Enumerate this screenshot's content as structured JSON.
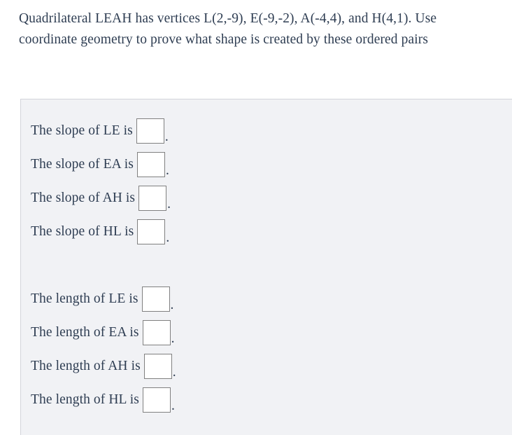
{
  "question": {
    "text": "Quadrilateral LEAH has vertices L(2,-9), E(-9,-2), A(-4,4), and H(4,1). Use coordinate geometry to prove what shape is created by these ordered pairs"
  },
  "answer_panel": {
    "background_color": "#f1f2f5",
    "border_color": "#d3d4db",
    "groups": [
      {
        "name": "slopes",
        "rows": [
          {
            "label": "The slope of LE is",
            "value": "",
            "suffix": "."
          },
          {
            "label": "The slope of EA is",
            "value": "",
            "suffix": "."
          },
          {
            "label": "The slope of AH is",
            "value": "",
            "suffix": "."
          },
          {
            "label": "The slope of HL is",
            "value": "",
            "suffix": "."
          }
        ]
      },
      {
        "name": "lengths",
        "rows": [
          {
            "label": "The length of LE is",
            "value": "",
            "suffix": "."
          },
          {
            "label": "The length of EA is",
            "value": "",
            "suffix": "."
          },
          {
            "label": "The length of AH is",
            "value": "",
            "suffix": "."
          },
          {
            "label": "The length of HL is",
            "value": "",
            "suffix": "."
          }
        ]
      }
    ]
  },
  "colors": {
    "text": "#2e3d52",
    "panel_fill": "#f1f2f5",
    "panel_border": "#d3d4db",
    "input_border": "#808080",
    "input_fill": "#ffffff",
    "page_background": "#ffffff"
  }
}
